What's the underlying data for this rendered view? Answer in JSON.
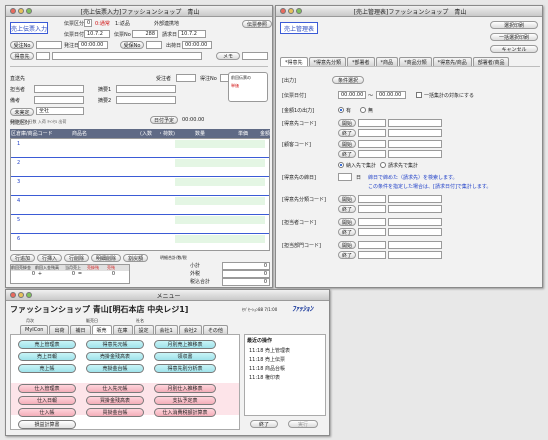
{
  "win1": {
    "title": "[売上伝票入力]ファッションショップ　青山",
    "badge": "売上伝票入力",
    "denpyo_kubun_label": "伝票区分",
    "denpyo_kubun_val": "0",
    "kubun_red": "0:通常",
    "kubun_mid": "1:返品",
    "gaibu_label": "外部連携地",
    "kaisha_btn": "伝票参照",
    "denpyo_date_label": "伝票日付",
    "denpyo_date_val": "10.7.2",
    "denpyo_no_label": "伝票No",
    "denpyo_no_val": "288",
    "seikyu_label": "請求日",
    "seikyu_val": "10.7.2",
    "juchu_btn": "受注No",
    "hasso_label": "発注日",
    "time1": "00:00.00",
    "hokan_btn": "受保No",
    "shukka_label": "出荷日",
    "time2": "00:00.00",
    "tokui_btn": "得意先",
    "memo_btn": "メモ",
    "chokuso_label": "直送先",
    "bunrui_label": "受注者",
    "kyaku_label": "得注No",
    "tantou_label": "担当者",
    "jisha1": "摘要1",
    "biko_label": "備考",
    "jisha2": "摘要2",
    "hassou_label": "発送区分",
    "hassou_val": "全社",
    "kakuritsu_btn": "未実定",
    "lockpanel_a": "前回伝票の",
    "lockpanel_b": "単価",
    "sub_row": "伝票 未定 日数  入荷  ｷｬﾝｾﾙ 出荷",
    "right_btn2": "日付予定",
    "right_time": "00:00.00",
    "table_headers": [
      "区",
      "倉庫/商品コード",
      "商品名",
      "(入数",
      "・荷数)",
      "数量",
      "単価",
      "金額"
    ],
    "row_numbers": [
      "1",
      "2",
      "3",
      "4",
      "5",
      "6"
    ],
    "bottom_btns": [
      "行追加",
      "行挿入",
      "行削除",
      "明細削除",
      "割戻額"
    ],
    "bottom_label": "明細合計/数/税",
    "sum_labels": [
      "小計",
      "外税",
      "税込合計"
    ],
    "sum_vals": [
      "0",
      "0",
      "0"
    ],
    "foot_headers": [
      "前回売掛金",
      "前回入金残高",
      "当月売上",
      "売掛残",
      "売残"
    ],
    "foot_vals": [
      "0",
      "+",
      "0",
      "=",
      "0"
    ]
  },
  "win2": {
    "title": "[売上管理表]ファッションショップ　青山",
    "badge": "売上管理表",
    "btn_print": "選択印刷",
    "btn_all": "一括選択印刷",
    "btn_cancel": "キャンセル",
    "tabs": [
      "*得意先",
      "*得意先分類",
      "*部署者",
      "*商品",
      "*商品分類",
      "*得意先/商品",
      "部署者/商品"
    ],
    "r_kikan": "[出力]",
    "kikan_btn": "条件選択",
    "r_date": "[伝票日付]",
    "date_from": "00.00.00",
    "date_to": "00.00.00",
    "date_chk": "一括集計の対象にする",
    "r_nyu": "[金額1の出力]",
    "radio_a": "有",
    "radio_b": "無",
    "r_tokui": "[得意先コード]",
    "btn_kaishi": "開始",
    "btn_owari": "終了",
    "r_busho": "[顧客コード]",
    "radio_c": "納入先で集計",
    "radio_d": "請求先で集計",
    "r_shime": "[得意先の締日]",
    "shime_note1": "締日で締めた（請求先）を検索します。",
    "shime_note2": "この条件を指定した場合は、[請求日付]で集計します。",
    "r_bunrui": "[得意先分類コード]",
    "r_tanto": "[担当者コード]",
    "r_busyo": "[担当部門コード]"
  },
  "win3": {
    "title": "メニュー",
    "header": "ファッションショップ 青山[明石本店 中央レジ1]",
    "header_info": "ｾｷﾞｾｰｼｮﾝ88 7/1:00",
    "logo": "ﾌｧｯｼｮﾝ",
    "sub1": "月次",
    "sub2": "販売日",
    "sub3": "社名",
    "tabs": [
      "MyICon",
      "出荷",
      "補日",
      "販売",
      "在庫",
      "設定",
      "会社1",
      "会社2",
      "その他"
    ],
    "recent_title": "最近の操作",
    "recent": [
      "11:18 売上管理表",
      "11:18 売上伝票",
      "11:18 商品台帳",
      "11:18 権印表"
    ],
    "col1": [
      "売上管理表",
      "売上日報",
      "売上帳",
      "仕入管理表",
      "仕入日報",
      "仕入帳",
      "損益計算書"
    ],
    "col2": [
      "得意先元帳",
      "売掛金残高表",
      "売掛金台帳",
      "仕入先元帳",
      "買掛金残高表",
      "買掛金台帳"
    ],
    "col3": [
      "月別売上推移表",
      "領収書",
      "得意先別分析表",
      "月別仕入推移表",
      "支払予定表",
      "仕入消費税額計算表"
    ],
    "btn_close": "終了",
    "btn_run": "実行"
  }
}
